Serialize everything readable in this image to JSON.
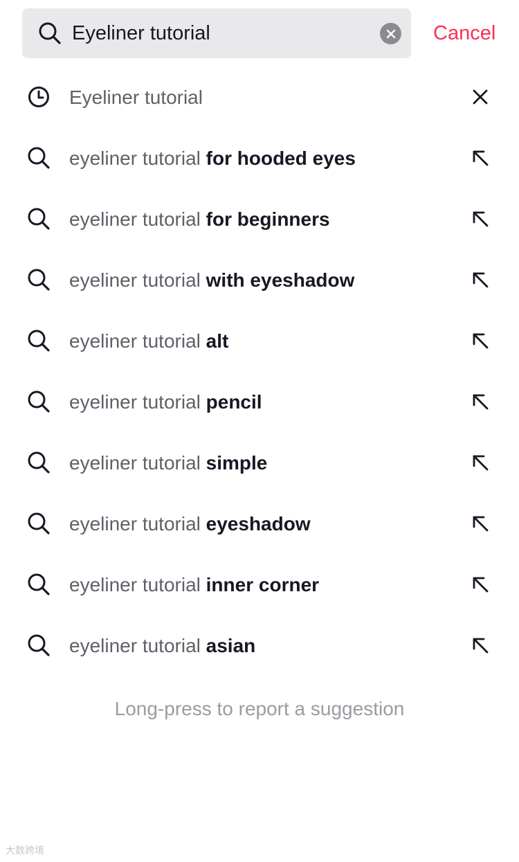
{
  "search": {
    "value": "Eyeliner tutorial",
    "cancel_label": "Cancel"
  },
  "history": {
    "label": "Eyeliner tutorial"
  },
  "suggestions": [
    {
      "prefix": "eyeliner tutorial ",
      "suffix": "for hooded eyes"
    },
    {
      "prefix": "eyeliner tutorial ",
      "suffix": "for beginners"
    },
    {
      "prefix": "eyeliner tutorial ",
      "suffix": "with eyeshadow"
    },
    {
      "prefix": "eyeliner tutorial ",
      "suffix": "alt"
    },
    {
      "prefix": "eyeliner tutorial ",
      "suffix": "pencil"
    },
    {
      "prefix": "eyeliner tutorial ",
      "suffix": "simple"
    },
    {
      "prefix": "eyeliner tutorial ",
      "suffix": "eyeshadow"
    },
    {
      "prefix": "eyeliner tutorial ",
      "suffix": "inner corner"
    },
    {
      "prefix": "eyeliner tutorial ",
      "suffix": "asian"
    }
  ],
  "footer": {
    "note": "Long-press to report a suggestion"
  },
  "watermark": {
    "text": "大数跨境"
  },
  "icons": {
    "search": "search-icon",
    "clear": "clear-circle-icon",
    "history": "clock-icon",
    "remove": "close-icon",
    "fill": "arrow-up-left-icon"
  },
  "colors": {
    "accent": "#fe2c55",
    "search_bg": "#e9e9ec",
    "text_primary": "#161823",
    "text_secondary": "#5f6068",
    "text_muted": "#9b9ca2"
  }
}
